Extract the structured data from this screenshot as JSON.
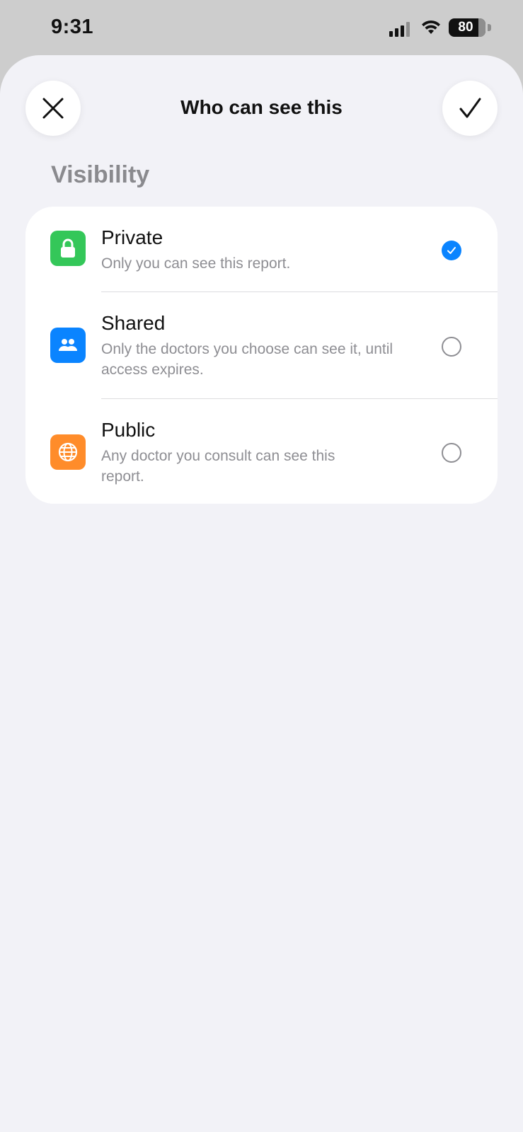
{
  "status": {
    "time": "9:31",
    "battery": "80",
    "battery_level": 0.8
  },
  "header": {
    "title": "Who can see this"
  },
  "section": {
    "title": "Visibility"
  },
  "options": [
    {
      "title": "Private",
      "desc": "Only you can see this report.",
      "icon": "lock-icon",
      "color": "#34c759",
      "selected": true
    },
    {
      "title": "Shared",
      "desc": "Only the doctors you choose can see it, until access expires.",
      "icon": "people-icon",
      "color": "#0a84ff",
      "selected": false
    },
    {
      "title": "Public",
      "desc": "Any doctor you consult can see this report.",
      "icon": "globe-icon",
      "color": "#ff8c2a",
      "selected": false
    }
  ]
}
